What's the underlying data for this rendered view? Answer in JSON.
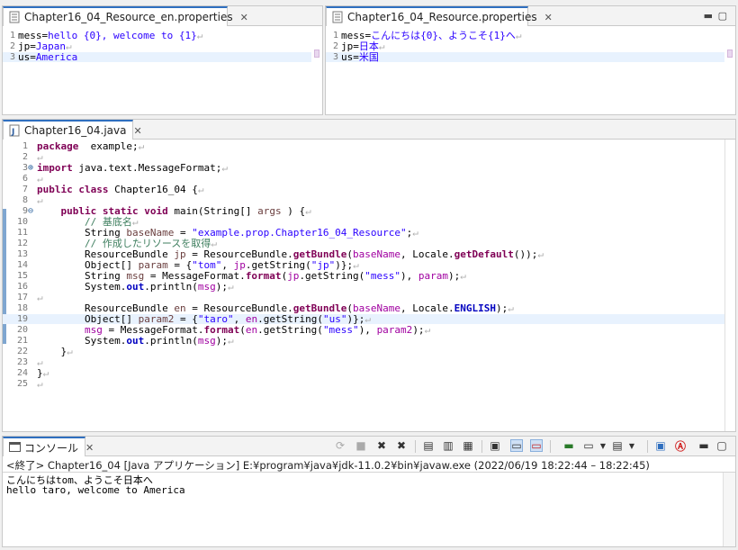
{
  "props_en": {
    "tab_title": "Chapter16_04_Resource_en.properties",
    "lines": [
      {
        "n": "1",
        "key": "mess",
        "value": "hello {0}, welcome to {1}"
      },
      {
        "n": "2",
        "key": "jp",
        "value": "Japan"
      },
      {
        "n": "3",
        "key": "us",
        "value": "America"
      }
    ]
  },
  "props_ja": {
    "tab_title": "Chapter16_04_Resource.properties",
    "lines": [
      {
        "n": "1",
        "key": "mess",
        "value": "こんにちは{0}、ようこそ{1}へ"
      },
      {
        "n": "2",
        "key": "jp",
        "value": "日本"
      },
      {
        "n": "3",
        "key": "us",
        "value": "米国"
      }
    ]
  },
  "java_editor": {
    "tab_title": "Chapter16_04.java",
    "folded_marker": "⊕",
    "expand_marker": "⊖"
  },
  "java_lines": [
    {
      "n": "1",
      "parts": [
        [
          "kw",
          "package"
        ],
        [
          "",
          "  example;"
        ]
      ]
    },
    {
      "n": "2",
      "parts": []
    },
    {
      "n": "3",
      "parts": [
        [
          "kw",
          "import"
        ],
        [
          "",
          " java.text.MessageFormat;"
        ]
      ]
    },
    {
      "n": "6",
      "parts": []
    },
    {
      "n": "7",
      "parts": [
        [
          "kw",
          "public"
        ],
        [
          "",
          " "
        ],
        [
          "kw",
          "class"
        ],
        [
          "",
          " Chapter16_04 {"
        ]
      ]
    },
    {
      "n": "8",
      "parts": []
    },
    {
      "n": "9",
      "parts": [
        [
          "",
          "    "
        ],
        [
          "kw",
          "public"
        ],
        [
          "",
          " "
        ],
        [
          "kw",
          "static"
        ],
        [
          "",
          " "
        ],
        [
          "kw",
          "void"
        ],
        [
          "",
          " main(String[] "
        ],
        [
          "var",
          "args"
        ],
        [
          "",
          " ) {"
        ]
      ]
    },
    {
      "n": "10",
      "parts": [
        [
          "",
          "        "
        ],
        [
          "cm",
          "// 基底名"
        ]
      ]
    },
    {
      "n": "11",
      "parts": [
        [
          "",
          "        String "
        ],
        [
          "var",
          "baseName"
        ],
        [
          "",
          " = "
        ],
        [
          "str",
          "\"example.prop.Chapter16_04_Resource\""
        ],
        [
          "",
          ";"
        ]
      ]
    },
    {
      "n": "12",
      "parts": [
        [
          "",
          "        "
        ],
        [
          "cm",
          "// 作成したリソースを取得"
        ]
      ]
    },
    {
      "n": "13",
      "parts": [
        [
          "",
          "        ResourceBundle "
        ],
        [
          "var",
          "jp"
        ],
        [
          "",
          " = ResourceBundle."
        ],
        [
          "kw",
          "getBundle"
        ],
        [
          "",
          "("
        ],
        [
          "prm",
          "baseName"
        ],
        [
          "",
          ", Locale."
        ],
        [
          "kw",
          "getDefault"
        ],
        [
          "",
          "());"
        ]
      ]
    },
    {
      "n": "14",
      "parts": [
        [
          "",
          "        Object[] "
        ],
        [
          "var",
          "param"
        ],
        [
          "",
          " = {"
        ],
        [
          "str",
          "\"tom\""
        ],
        [
          "",
          ", "
        ],
        [
          "prm",
          "jp"
        ],
        [
          "",
          ".getString("
        ],
        [
          "str",
          "\"jp\""
        ],
        [
          "",
          ")};"
        ]
      ]
    },
    {
      "n": "15",
      "parts": [
        [
          "",
          "        String "
        ],
        [
          "var",
          "msg"
        ],
        [
          "",
          " = MessageFormat."
        ],
        [
          "kw",
          "format"
        ],
        [
          "",
          "("
        ],
        [
          "prm",
          "jp"
        ],
        [
          "",
          ".getString("
        ],
        [
          "str",
          "\"mess\""
        ],
        [
          "",
          "), "
        ],
        [
          "prm",
          "param"
        ],
        [
          "",
          ");"
        ]
      ]
    },
    {
      "n": "16",
      "parts": [
        [
          "",
          "        System."
        ],
        [
          "fld",
          "out"
        ],
        [
          "",
          ".println("
        ],
        [
          "prm",
          "msg"
        ],
        [
          "",
          ");"
        ]
      ]
    },
    {
      "n": "17",
      "parts": []
    },
    {
      "n": "18",
      "parts": [
        [
          "",
          "        ResourceBundle "
        ],
        [
          "var",
          "en"
        ],
        [
          "",
          " = ResourceBundle."
        ],
        [
          "kw",
          "getBundle"
        ],
        [
          "",
          "("
        ],
        [
          "prm",
          "baseName"
        ],
        [
          "",
          ", Locale."
        ],
        [
          "fld",
          "ENGLISH"
        ],
        [
          "",
          ");"
        ]
      ]
    },
    {
      "n": "19",
      "parts": [
        [
          "",
          "        Object[] "
        ],
        [
          "var",
          "param2"
        ],
        [
          "",
          " = {"
        ],
        [
          "str",
          "\"taro\""
        ],
        [
          "",
          ", "
        ],
        [
          "prm",
          "en"
        ],
        [
          "",
          ".getString("
        ],
        [
          "str",
          "\"us\""
        ],
        [
          "",
          ")};"
        ]
      ]
    },
    {
      "n": "20",
      "parts": [
        [
          "",
          "        "
        ],
        [
          "prm",
          "msg"
        ],
        [
          "",
          " = MessageFormat."
        ],
        [
          "kw",
          "format"
        ],
        [
          "",
          "("
        ],
        [
          "prm",
          "en"
        ],
        [
          "",
          ".getString("
        ],
        [
          "str",
          "\"mess\""
        ],
        [
          "",
          "), "
        ],
        [
          "prm",
          "param2"
        ],
        [
          "",
          ");"
        ]
      ]
    },
    {
      "n": "21",
      "parts": [
        [
          "",
          "        System."
        ],
        [
          "fld",
          "out"
        ],
        [
          "",
          ".println("
        ],
        [
          "prm",
          "msg"
        ],
        [
          "",
          ");"
        ]
      ]
    },
    {
      "n": "22",
      "parts": [
        [
          "",
          "    }"
        ]
      ]
    },
    {
      "n": "23",
      "parts": []
    },
    {
      "n": "24",
      "parts": [
        [
          "",
          "}"
        ]
      ]
    },
    {
      "n": "25",
      "parts": []
    }
  ],
  "console": {
    "tab_title": "コンソール",
    "status": "<終了> Chapter16_04 [Java アプリケーション] E:¥program¥java¥jdk-11.0.2¥bin¥javaw.exe  (2022/06/19 18:22:44 – 18:22:45)",
    "output": [
      "こんにちはtom、ようこそ日本へ",
      "hello taro, welcome to America"
    ]
  },
  "colors": {
    "accent": "#2f6fbf",
    "keyword": "#7f0055",
    "string": "#2a00ff",
    "comment": "#3f7f5f",
    "highlight_line": "#e8f2fe"
  }
}
